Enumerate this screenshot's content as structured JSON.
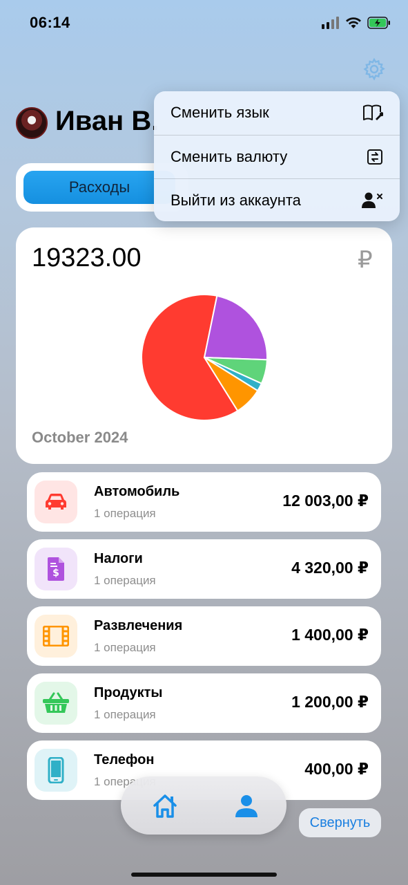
{
  "status_bar": {
    "time": "06:14"
  },
  "header": {
    "user_name": "Иван В.",
    "settings_icon": "gear-icon"
  },
  "segment": {
    "active_label": "Расходы"
  },
  "menu": {
    "items": [
      {
        "label": "Сменить язык",
        "icon": "book-wrench-icon"
      },
      {
        "label": "Сменить валюту",
        "icon": "currency-swap-icon"
      },
      {
        "label": "Выйти из аккаунта",
        "icon": "user-remove-icon"
      }
    ]
  },
  "summary": {
    "amount": "19323.00",
    "currency_symbol": "₽",
    "period": "October 2024"
  },
  "categories": [
    {
      "name": "Автомобиль",
      "ops": "1 операция",
      "amount": "12 003,00 ₽",
      "icon": "car-icon",
      "color": "#ff3b30",
      "bg": "#ffe5e4"
    },
    {
      "name": "Налоги",
      "ops": "1 операция",
      "amount": "4 320,00 ₽",
      "icon": "tax-document-icon",
      "color": "#af52de",
      "bg": "#f1e4fa"
    },
    {
      "name": "Развлечения",
      "ops": "1 операция",
      "amount": "1 400,00 ₽",
      "icon": "film-icon",
      "color": "#ff9500",
      "bg": "#fff0dc"
    },
    {
      "name": "Продукты",
      "ops": "1 операция",
      "amount": "1 200,00 ₽",
      "icon": "basket-icon",
      "color": "#34c759",
      "bg": "#e3f7e8"
    },
    {
      "name": "Телефон",
      "ops": "1 операция",
      "amount": "400,00 ₽",
      "icon": "phone-icon",
      "color": "#30b0c7",
      "bg": "#dff3f7"
    }
  ],
  "chart_data": {
    "type": "pie",
    "slices": [
      {
        "category": "Автомобиль",
        "value": 12003,
        "color": "#ff3b30"
      },
      {
        "category": "Налоги",
        "value": 4320,
        "color": "#af52de"
      },
      {
        "category": "Продукты",
        "value": 1200,
        "color": "#5fd47a"
      },
      {
        "category": "Телефон",
        "value": 400,
        "color": "#30b0c7"
      },
      {
        "category": "Развлечения",
        "value": 1400,
        "color": "#ff9500"
      }
    ]
  },
  "bottom": {
    "collapse_label": "Свернуть"
  }
}
